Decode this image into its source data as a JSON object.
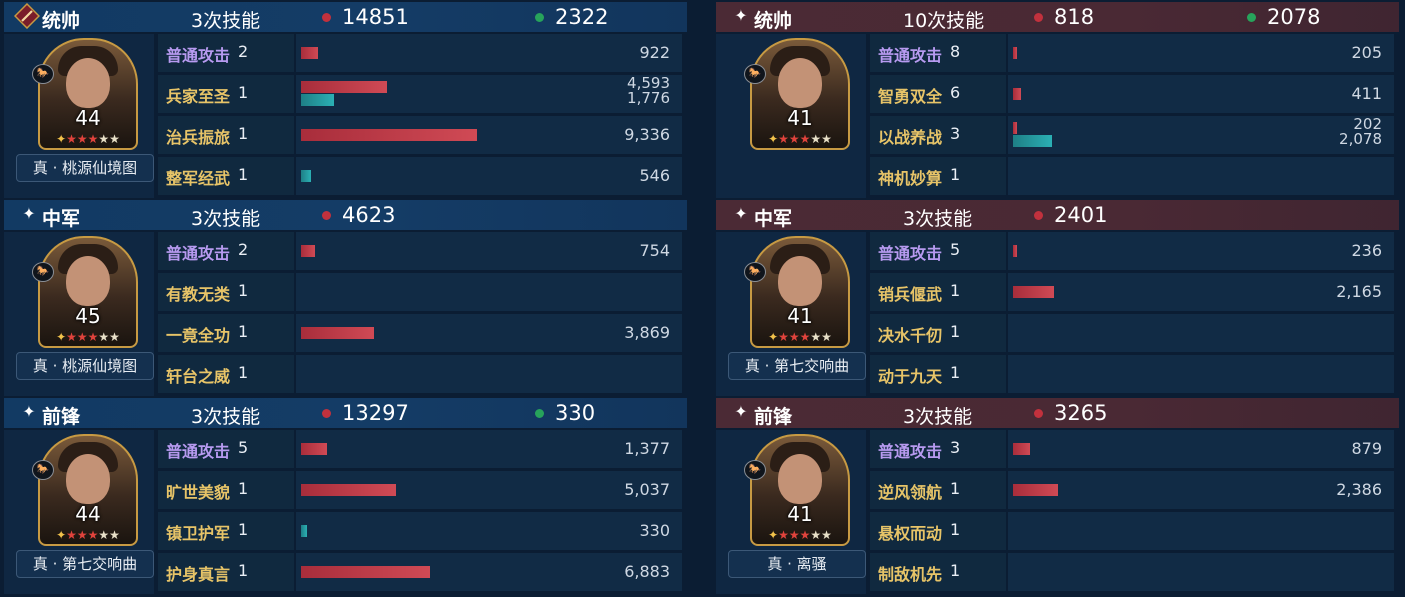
{
  "left": [
    {
      "role": "统帅",
      "times": "3次技能",
      "red": "14851",
      "green": "2322",
      "level": "44",
      "tag": "真 · 桃源仙境图",
      "skills": [
        {
          "name": "普通攻击",
          "count": "2",
          "color": "purple",
          "red": 922,
          "teal": null,
          "val_red": "922",
          "val_teal": ""
        },
        {
          "name": "兵家至圣",
          "count": "1",
          "color": "gold",
          "red": 4593,
          "teal": 1776,
          "val_red": "4,593",
          "val_teal": "1,776"
        },
        {
          "name": "治兵振旅",
          "count": "1",
          "color": "gold",
          "red": 9336,
          "teal": null,
          "val_red": "9,336",
          "val_teal": ""
        },
        {
          "name": "整军经武",
          "count": "1",
          "color": "gold",
          "red": null,
          "teal": 546,
          "val_red": "",
          "val_teal": "546"
        }
      ]
    },
    {
      "role": "中军",
      "times": "3次技能",
      "red": "4623",
      "green": "",
      "level": "45",
      "tag": "真 · 桃源仙境图",
      "skills": [
        {
          "name": "普通攻击",
          "count": "2",
          "color": "purple",
          "red": 754,
          "teal": null,
          "val_red": "754",
          "val_teal": ""
        },
        {
          "name": "有教无类",
          "count": "1",
          "color": "gold",
          "red": null,
          "teal": null,
          "val_red": "",
          "val_teal": ""
        },
        {
          "name": "一竟全功",
          "count": "1",
          "color": "gold",
          "red": 3869,
          "teal": null,
          "val_red": "3,869",
          "val_teal": ""
        },
        {
          "name": "轩台之威",
          "count": "1",
          "color": "gold",
          "red": null,
          "teal": null,
          "val_red": "",
          "val_teal": ""
        }
      ]
    },
    {
      "role": "前锋",
      "times": "3次技能",
      "red": "13297",
      "green": "330",
      "level": "44",
      "tag": "真 · 第七交响曲",
      "skills": [
        {
          "name": "普通攻击",
          "count": "5",
          "color": "purple",
          "red": 1377,
          "teal": null,
          "val_red": "1,377",
          "val_teal": ""
        },
        {
          "name": "旷世美貌",
          "count": "1",
          "color": "gold",
          "red": 5037,
          "teal": null,
          "val_red": "5,037",
          "val_teal": ""
        },
        {
          "name": "镇卫护军",
          "count": "1",
          "color": "gold",
          "red": null,
          "teal": 330,
          "val_red": "",
          "val_teal": "330"
        },
        {
          "name": "护身真言",
          "count": "1",
          "color": "gold",
          "red": 6883,
          "teal": null,
          "val_red": "6,883",
          "val_teal": ""
        }
      ]
    }
  ],
  "right": [
    {
      "role": "统帅",
      "times": "10次技能",
      "red": "818",
      "green": "2078",
      "level": "41",
      "tag": "",
      "skills": [
        {
          "name": "普通攻击",
          "count": "8",
          "color": "purple",
          "red": 205,
          "teal": null,
          "val_red": "205",
          "val_teal": ""
        },
        {
          "name": "智勇双全",
          "count": "6",
          "color": "gold",
          "red": 411,
          "teal": null,
          "val_red": "411",
          "val_teal": ""
        },
        {
          "name": "以战养战",
          "count": "3",
          "color": "gold",
          "red": 202,
          "teal": 2078,
          "val_red": "202",
          "val_teal": "2,078"
        },
        {
          "name": "神机妙算",
          "count": "1",
          "color": "gold",
          "red": null,
          "teal": null,
          "val_red": "",
          "val_teal": ""
        }
      ]
    },
    {
      "role": "中军",
      "times": "3次技能",
      "red": "2401",
      "green": "",
      "level": "41",
      "tag": "真 · 第七交响曲",
      "skills": [
        {
          "name": "普通攻击",
          "count": "5",
          "color": "purple",
          "red": 236,
          "teal": null,
          "val_red": "236",
          "val_teal": ""
        },
        {
          "name": "销兵偃武",
          "count": "1",
          "color": "gold",
          "red": 2165,
          "teal": null,
          "val_red": "2,165",
          "val_teal": ""
        },
        {
          "name": "决水千仞",
          "count": "1",
          "color": "gold",
          "red": null,
          "teal": null,
          "val_red": "",
          "val_teal": ""
        },
        {
          "name": "动于九天",
          "count": "1",
          "color": "gold",
          "red": null,
          "teal": null,
          "val_red": "",
          "val_teal": ""
        }
      ]
    },
    {
      "role": "前锋",
      "times": "3次技能",
      "red": "3265",
      "green": "",
      "level": "41",
      "tag": "真 · 离骚",
      "skills": [
        {
          "name": "普通攻击",
          "count": "3",
          "color": "purple",
          "red": 879,
          "teal": null,
          "val_red": "879",
          "val_teal": ""
        },
        {
          "name": "逆风领航",
          "count": "1",
          "color": "gold",
          "red": 2386,
          "teal": null,
          "val_red": "2,386",
          "val_teal": ""
        },
        {
          "name": "悬权而动",
          "count": "1",
          "color": "gold",
          "red": null,
          "teal": null,
          "val_red": "",
          "val_teal": ""
        },
        {
          "name": "制敌机先",
          "count": "1",
          "color": "gold",
          "red": null,
          "teal": null,
          "val_red": "",
          "val_teal": ""
        }
      ]
    }
  ],
  "icons": {
    "role_badge": "commander-badge-icon",
    "role_star": "four-point-star-icon",
    "red_dot": "damage-dot-icon",
    "green_dot": "heal-dot-icon",
    "mount": "horse-icon"
  },
  "colors": {
    "red_bar": "#c2313d",
    "teal_bar": "#2bb0b4",
    "purple_label": "#b79af0",
    "gold_label": "#e7c468",
    "star_gold": "#f2c24b",
    "star_red": "#e0433c"
  }
}
